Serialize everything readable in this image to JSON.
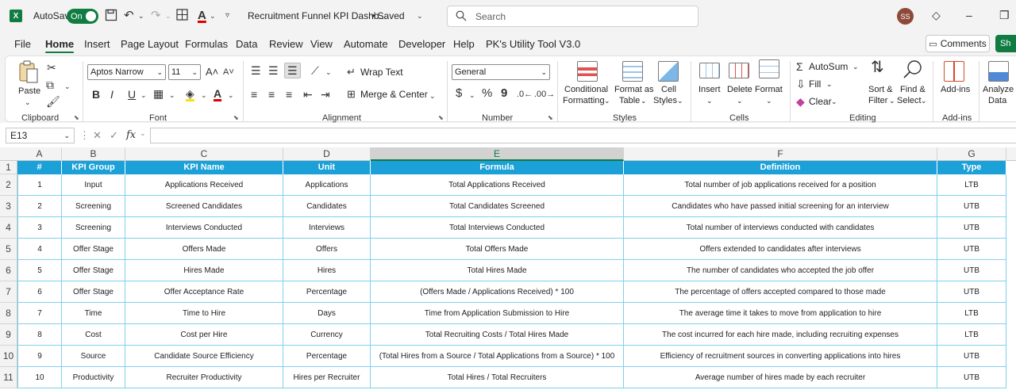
{
  "titlebar": {
    "app_logo": "X",
    "autosave_label": "AutoSave",
    "autosave_state": "On",
    "doc_title": "Recruitment Funnel KPI Dashb...",
    "saved_status": "• Saved",
    "search_placeholder": "Search",
    "avatar_initials": "SS"
  },
  "menu": {
    "tabs": [
      "File",
      "Home",
      "Insert",
      "Page Layout",
      "Formulas",
      "Data",
      "Review",
      "View",
      "Automate",
      "Developer",
      "Help",
      "PK's Utility Tool V3.0"
    ],
    "active": "Home",
    "comments_label": "Comments",
    "share_label": "Sh"
  },
  "ribbon": {
    "clipboard": {
      "paste": "Paste",
      "label": "Clipboard"
    },
    "font": {
      "name": "Aptos Narrow",
      "size": "11",
      "label": "Font",
      "bold": "B",
      "italic": "I",
      "underline": "U"
    },
    "alignment": {
      "wrap": "Wrap Text",
      "merge": "Merge & Center",
      "label": "Alignment"
    },
    "number": {
      "format": "General",
      "currency": "$",
      "percent": "%",
      "comma": "9",
      "label": "Number"
    },
    "styles": {
      "conditional_1": "Conditional",
      "conditional_2": "Formatting",
      "format_as_1": "Format as",
      "format_as_2": "Table",
      "cell_styles_1": "Cell",
      "cell_styles_2": "Styles",
      "label": "Styles"
    },
    "cells": {
      "insert": "Insert",
      "delete": "Delete",
      "format": "Format",
      "label": "Cells"
    },
    "editing": {
      "autosum": "AutoSum",
      "fill": "Fill",
      "clear": "Clear",
      "sort_1": "Sort &",
      "sort_2": "Filter",
      "find_1": "Find &",
      "find_2": "Select",
      "label": "Editing"
    },
    "addins": {
      "addins": "Add-ins",
      "label": "Add-ins"
    },
    "analyze": {
      "line1": "Analyze",
      "line2": "Data"
    }
  },
  "formula_bar": {
    "name_box": "E13",
    "fx": "fx",
    "content": ""
  },
  "columns": [
    "A",
    "B",
    "C",
    "D",
    "E",
    "F",
    "G"
  ],
  "selected_column": "E",
  "row_numbers": [
    "1",
    "2",
    "3",
    "4",
    "5",
    "6",
    "7",
    "8",
    "9",
    "10",
    "11"
  ],
  "table": {
    "headers": [
      "#",
      "KPI Group",
      "KPI Name",
      "Unit",
      "Formula",
      "Definition",
      "Type"
    ],
    "rows": [
      [
        "1",
        "Input",
        "Applications Received",
        "Applications",
        "Total Applications Received",
        "Total number of job applications received for a position",
        "LTB"
      ],
      [
        "2",
        "Screening",
        "Screened Candidates",
        "Candidates",
        "Total Candidates Screened",
        "Candidates who have passed initial screening for an interview",
        "UTB"
      ],
      [
        "3",
        "Screening",
        "Interviews Conducted",
        "Interviews",
        "Total Interviews Conducted",
        "Total number of interviews conducted with candidates",
        "UTB"
      ],
      [
        "4",
        "Offer Stage",
        "Offers Made",
        "Offers",
        "Total Offers Made",
        "Offers extended to candidates after interviews",
        "UTB"
      ],
      [
        "5",
        "Offer Stage",
        "Hires Made",
        "Hires",
        "Total Hires Made",
        "The number of candidates who accepted the job offer",
        "UTB"
      ],
      [
        "6",
        "Offer Stage",
        "Offer Acceptance Rate",
        "Percentage",
        "(Offers Made / Applications Received) * 100",
        "The percentage of offers accepted compared to those made",
        "UTB"
      ],
      [
        "7",
        "Time",
        "Time to Hire",
        "Days",
        "Time from Application Submission to Hire",
        "The average time it takes to move from application to hire",
        "LTB"
      ],
      [
        "8",
        "Cost",
        "Cost per Hire",
        "Currency",
        "Total Recruiting Costs / Total Hires Made",
        "The cost incurred for each hire made, including recruiting expenses",
        "LTB"
      ],
      [
        "9",
        "Source",
        "Candidate Source Efficiency",
        "Percentage",
        "(Total Hires from a Source / Total Applications from a Source) * 100",
        "Efficiency of recruitment sources in converting applications into hires",
        "UTB"
      ],
      [
        "10",
        "Productivity",
        "Recruiter Productivity",
        "Hires per Recruiter",
        "Total Hires / Total Recruiters",
        "Average number of hires made by each recruiter",
        "UTB"
      ]
    ]
  },
  "colors": {
    "header_bg": "#1ba1d8",
    "grid_line": "#7fd0ee",
    "excel_green": "#107c41"
  }
}
